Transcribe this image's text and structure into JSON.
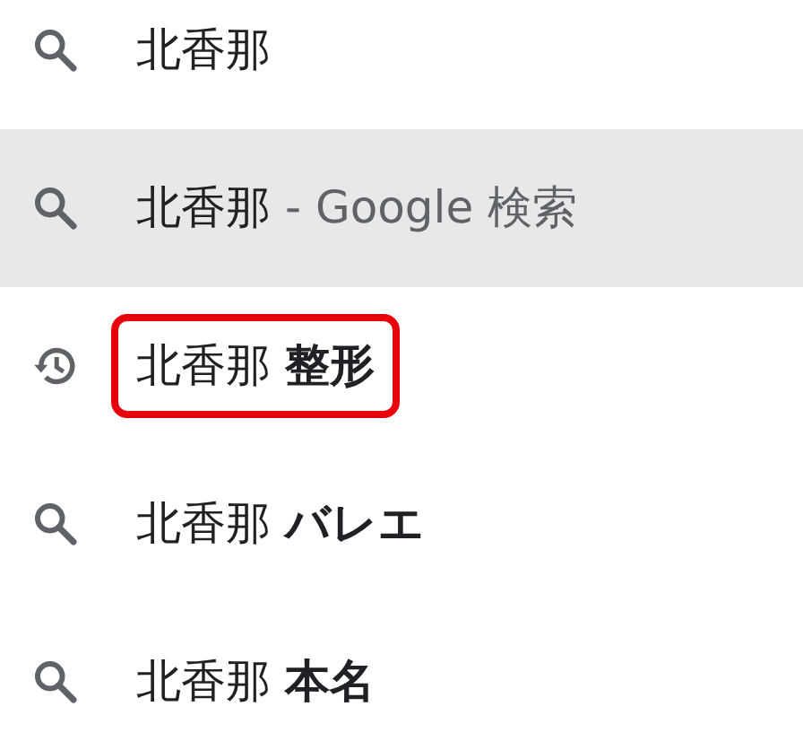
{
  "suggestions": [
    {
      "kind": "search",
      "text": "北香那",
      "selected": false,
      "outlined": false
    },
    {
      "kind": "search",
      "text": "北香那",
      "suffix": "- Google 検索",
      "selected": true,
      "outlined": false
    },
    {
      "kind": "history",
      "text": "北香那 **整形**",
      "selected": false,
      "outlined": true
    },
    {
      "kind": "search",
      "text": "北香那 **バレエ**",
      "selected": false,
      "outlined": false
    },
    {
      "kind": "search",
      "text": "北香那 **本名**",
      "selected": false,
      "outlined": false
    }
  ]
}
